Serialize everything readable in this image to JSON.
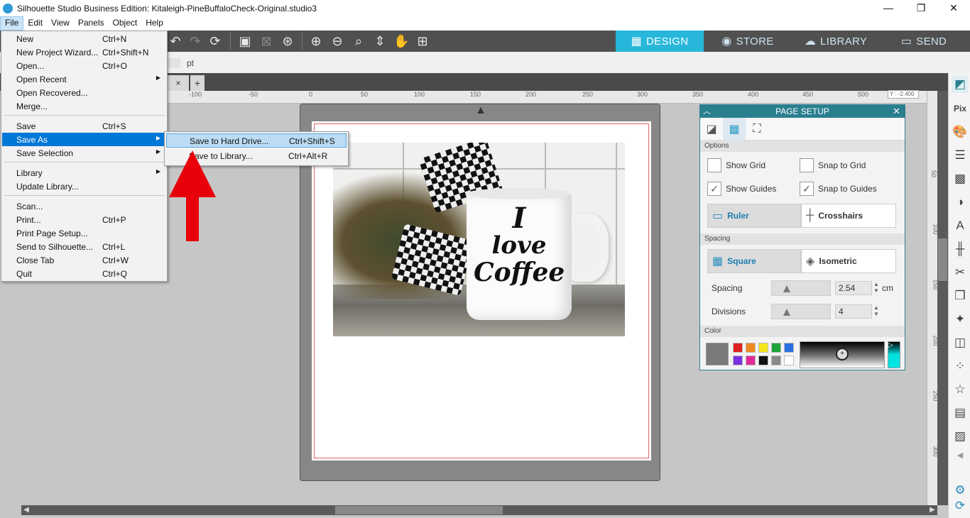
{
  "window": {
    "title": "Silhouette Studio Business Edition: Kitaleigh-PineBuffaloCheck-Original.studio3",
    "minimize": "—",
    "restore": "❐",
    "close": "✕"
  },
  "menubar": [
    "File",
    "Edit",
    "View",
    "Panels",
    "Object",
    "Help"
  ],
  "nav_tabs": {
    "design": "DESIGN",
    "store": "STORE",
    "library": "LIBRARY",
    "send": "SEND"
  },
  "subbar": {
    "unit": "pt"
  },
  "doc_tabs": {
    "close": "×",
    "add": "+"
  },
  "ruler": {
    "h_ticks": [
      "-100",
      "-50",
      "0",
      "50",
      "100",
      "150",
      "200",
      "250",
      "300",
      "350",
      "400",
      "450",
      "500"
    ],
    "v_ticks": [
      "50",
      "100",
      "150",
      "200",
      "250",
      "300"
    ],
    "y_readout": "Y : -2.400"
  },
  "photo": {
    "mug_line1": "I",
    "mug_line2": "love",
    "mug_line3": "Coffee"
  },
  "file_menu": {
    "items": [
      {
        "label": "New",
        "shortcut": "Ctrl+N"
      },
      {
        "label": "New Project Wizard...",
        "shortcut": "Ctrl+Shift+N"
      },
      {
        "label": "Open...",
        "shortcut": "Ctrl+O"
      },
      {
        "label": "Open Recent",
        "shortcut": ""
      },
      {
        "label": "Open Recovered...",
        "shortcut": ""
      },
      {
        "label": "Merge...",
        "shortcut": ""
      },
      {
        "label": "Save",
        "shortcut": "Ctrl+S"
      },
      {
        "label": "Save As",
        "shortcut": ""
      },
      {
        "label": "Save Selection",
        "shortcut": ""
      },
      {
        "label": "Library",
        "shortcut": ""
      },
      {
        "label": "Update Library...",
        "shortcut": ""
      },
      {
        "label": "Scan...",
        "shortcut": ""
      },
      {
        "label": "Print...",
        "shortcut": "Ctrl+P"
      },
      {
        "label": "Print Page Setup...",
        "shortcut": ""
      },
      {
        "label": "Send to Silhouette...",
        "shortcut": "Ctrl+L"
      },
      {
        "label": "Close Tab",
        "shortcut": "Ctrl+W"
      },
      {
        "label": "Quit",
        "shortcut": "Ctrl+Q"
      }
    ]
  },
  "save_as_submenu": {
    "items": [
      {
        "label": "Save to Hard Drive...",
        "shortcut": "Ctrl+Shift+S"
      },
      {
        "label": "Save to Library...",
        "shortcut": "Ctrl+Alt+R"
      }
    ]
  },
  "page_setup": {
    "title": "PAGE SETUP",
    "options_label": "Options",
    "show_grid": "Show Grid",
    "snap_to_grid": "Snap to Grid",
    "show_guides": "Show Guides",
    "snap_to_guides": "Snap to Guides",
    "show_grid_checked": false,
    "snap_to_grid_checked": false,
    "show_guides_checked": true,
    "snap_to_guides_checked": true,
    "ruler": "Ruler",
    "crosshairs": "Crosshairs",
    "spacing_section": "Spacing",
    "square": "Square",
    "isometric": "Isometric",
    "spacing_label": "Spacing",
    "spacing_value": "2.54",
    "spacing_unit": "cm",
    "divisions_label": "Divisions",
    "divisions_value": "4",
    "color_label": "Color",
    "swatches": [
      "#e02020",
      "#f08a20",
      "#f5e51d",
      "#1ea33a",
      "#2a6fe0",
      "#7a30e0",
      "#e02a96",
      "#111111",
      "#888888",
      "#ffffff"
    ]
  },
  "colors": {
    "accent": "#27b7da",
    "panel_header": "#2a7f8f",
    "toolbar": "#505050",
    "menu_highlight": "#0078d7",
    "annotation_arrow": "#e8000b"
  }
}
